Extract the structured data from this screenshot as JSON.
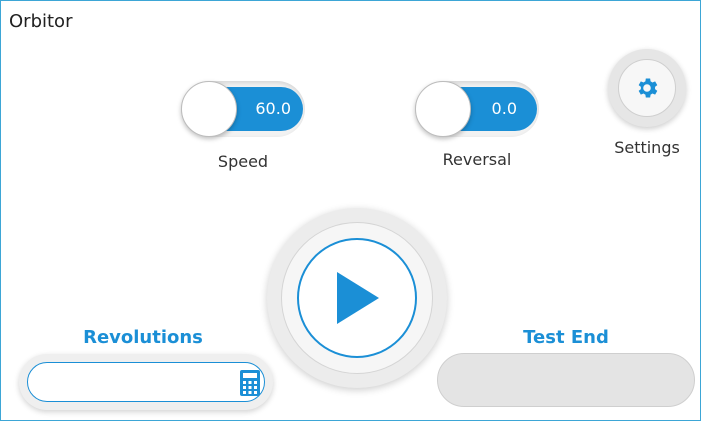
{
  "app": {
    "title": "Orbitor"
  },
  "speed": {
    "value": "60.0",
    "label": "Speed"
  },
  "reversal": {
    "value": "0.0",
    "label": "Reversal"
  },
  "settings": {
    "label": "Settings",
    "icon": "gear-icon"
  },
  "play": {
    "icon": "play-icon"
  },
  "revolutions": {
    "label": "Revolutions",
    "value": "",
    "icon": "calculator-icon"
  },
  "test_end": {
    "label": "Test End",
    "value": ""
  },
  "colors": {
    "accent": "#1b8fd6",
    "border": "#3da6d6"
  }
}
